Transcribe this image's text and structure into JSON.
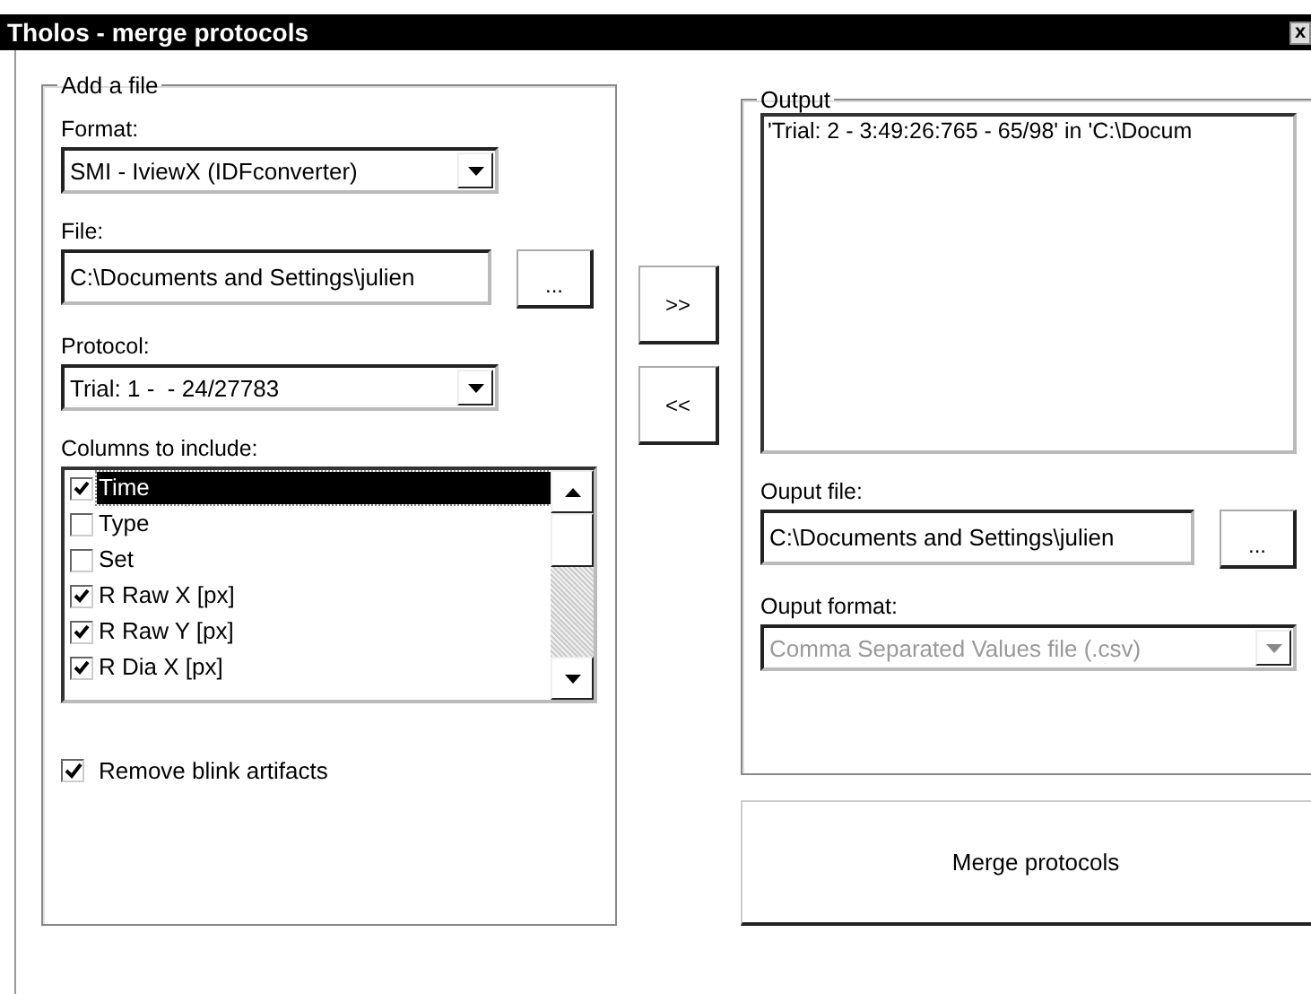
{
  "window": {
    "title": "Tholos - merge protocols",
    "close": "x"
  },
  "add_file": {
    "legend": "Add a file",
    "format": {
      "label": "Format:",
      "value": "SMI - IviewX (IDFconverter)"
    },
    "file": {
      "label": "File:",
      "value": "C:\\Documents and Settings\\julien",
      "browse": "..."
    },
    "protocol": {
      "label": "Protocol:",
      "value": "Trial: 1 -  - 24/27783"
    },
    "columns": {
      "label": "Columns to include:",
      "items": [
        {
          "label": "Time",
          "checked": true,
          "selected": true
        },
        {
          "label": "Type",
          "checked": false,
          "selected": false
        },
        {
          "label": "Set",
          "checked": false,
          "selected": false
        },
        {
          "label": "R Raw X [px]",
          "checked": true,
          "selected": false
        },
        {
          "label": "R Raw Y [px]",
          "checked": true,
          "selected": false
        },
        {
          "label": "R Dia X [px]",
          "checked": true,
          "selected": false
        }
      ]
    },
    "remove_blink": {
      "label": "Remove blink artifacts",
      "checked": true
    }
  },
  "move_buttons": [
    ">>",
    "<<"
  ],
  "output": {
    "legend": "Output",
    "lines": [
      "'Trial: 2 - 3:49:26:765 - 65/98' in 'C:\\Docum"
    ],
    "file": {
      "label": "Ouput file:",
      "value": "C:\\Documents and Settings\\julien",
      "browse": "..."
    },
    "format": {
      "label": "Ouput format:",
      "value": "Comma Separated Values file (.csv)",
      "disabled": true
    }
  },
  "merge_button": "Merge protocols"
}
